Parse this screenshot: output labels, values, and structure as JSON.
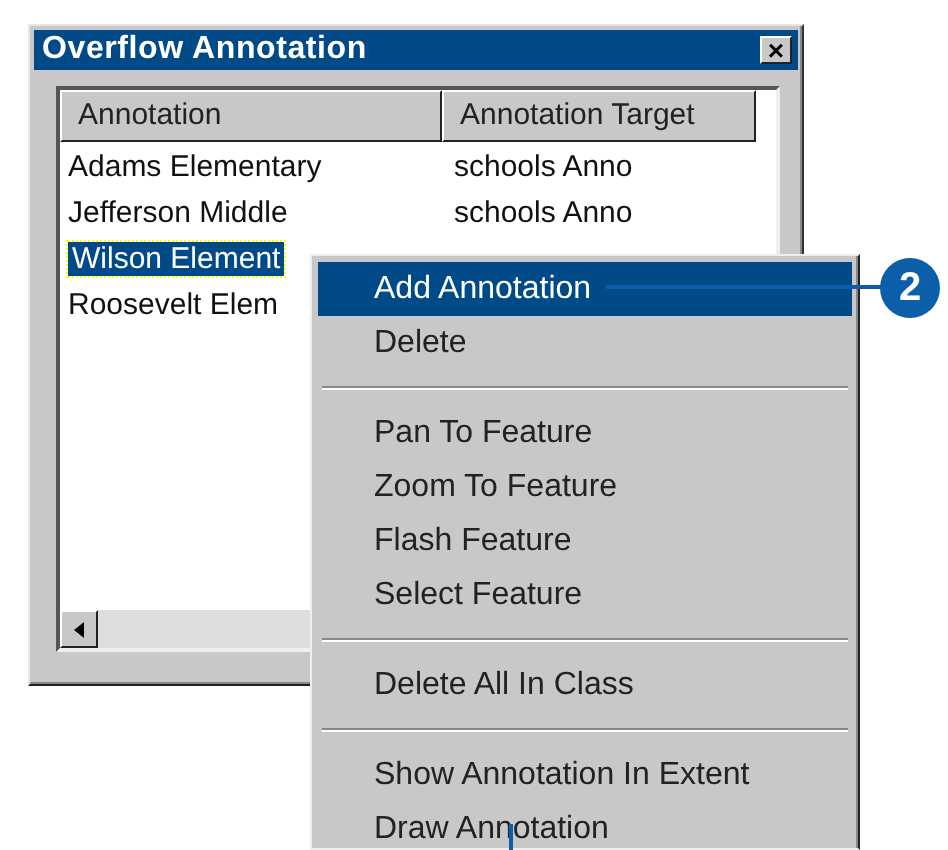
{
  "window": {
    "title": "Overflow Annotation",
    "close": "×"
  },
  "table": {
    "columns": [
      "Annotation",
      "Annotation Target"
    ],
    "rows": [
      {
        "cells": [
          "Adams Elementary",
          "schools Anno"
        ],
        "selected": false
      },
      {
        "cells": [
          "Jefferson Middle",
          "schools Anno"
        ],
        "selected": false
      },
      {
        "cells": [
          "Wilson Element"
        ],
        "selected": true
      },
      {
        "cells": [
          "Roosevelt Elem"
        ],
        "selected": false
      }
    ]
  },
  "context_menu": {
    "items": [
      {
        "kind": "item",
        "label": "Add Annotation",
        "selected": true
      },
      {
        "kind": "item",
        "label": "Delete",
        "selected": false
      },
      {
        "kind": "separator"
      },
      {
        "kind": "item",
        "label": "Pan To Feature",
        "selected": false
      },
      {
        "kind": "item",
        "label": "Zoom To Feature",
        "selected": false
      },
      {
        "kind": "item",
        "label": "Flash Feature",
        "selected": false
      },
      {
        "kind": "item",
        "label": "Select Feature",
        "selected": false
      },
      {
        "kind": "separator"
      },
      {
        "kind": "item",
        "label": "Delete All In Class",
        "selected": false
      },
      {
        "kind": "separator"
      },
      {
        "kind": "item",
        "label": "Show Annotation In Extent",
        "selected": false
      },
      {
        "kind": "item",
        "label": "Draw Annotation",
        "selected": false
      }
    ]
  },
  "callout": {
    "label": "2"
  }
}
